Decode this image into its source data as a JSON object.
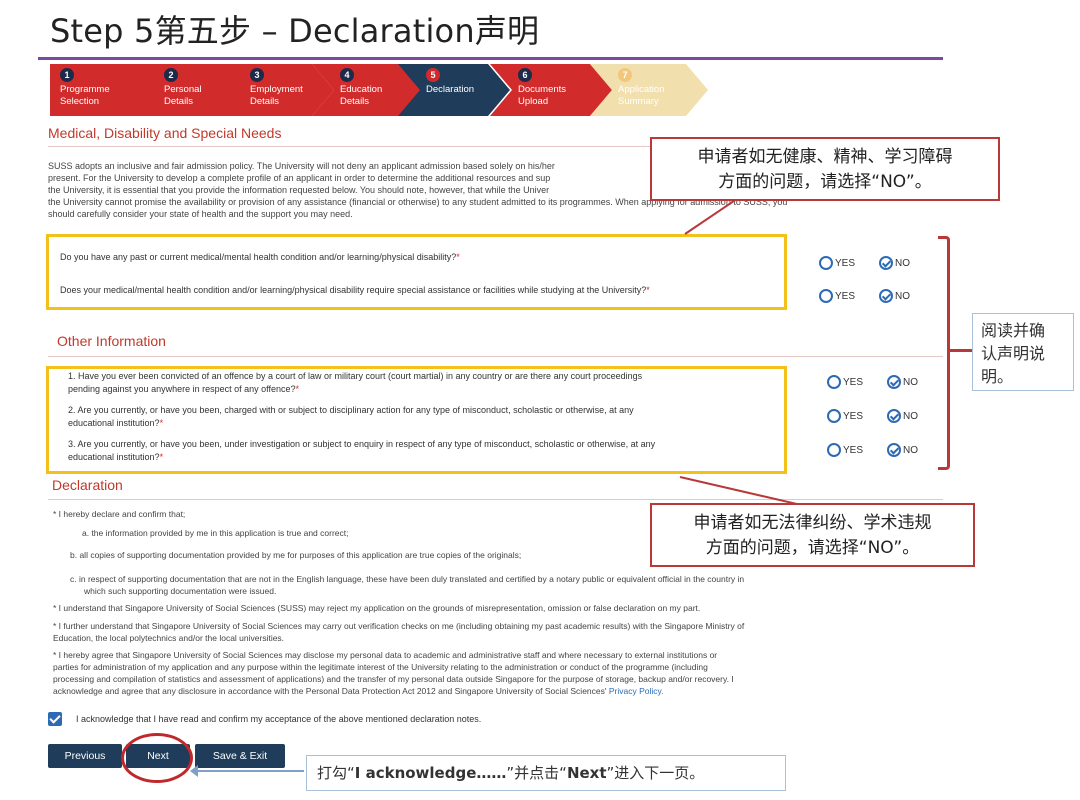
{
  "slide_title": "Step 5第五步 – Declaration声明",
  "steps": [
    {
      "num": "1",
      "line1": "Programme",
      "line2": "Selection"
    },
    {
      "num": "2",
      "line1": "Personal",
      "line2": "Details"
    },
    {
      "num": "3",
      "line1": "Employment",
      "line2": "Details"
    },
    {
      "num": "4",
      "line1": "Education",
      "line2": "Details"
    },
    {
      "num": "5",
      "line1": "Declaration",
      "line2": ""
    },
    {
      "num": "6",
      "line1": "Documents",
      "line2": "Upload"
    },
    {
      "num": "7",
      "line1": "Application",
      "line2": "Summary"
    }
  ],
  "colors": {
    "step_done": "#d12b2b",
    "step_active": "#1f3c5a",
    "step_future": "#f2dfae",
    "accent_red": "#c0392b",
    "box_yellow": "#f2c21a",
    "button_navy": "#1f3c5a"
  },
  "medical": {
    "title": "Medical, Disability and Special Needs",
    "intro": [
      "SUSS adopts an inclusive and fair admission policy. The University will not deny an applicant admission based solely on his/her",
      "present. For the University to develop a complete profile of an applicant in order to determine the additional resources and sup",
      "the University, it is essential that you provide the information requested below. You should note, however, that while the Univer",
      "the University cannot promise the availability or provision of any assistance (financial or otherwise) to any student admitted to its programmes. When applying for admission to SUSS, you",
      "should carefully consider your state of health and the support you may need."
    ],
    "q1": "Do you have any past or current medical/mental health condition and/or learning/physical disability?",
    "q2": "Does your medical/mental health condition and/or learning/physical disability require special assistance or facilities while studying at the University?"
  },
  "other": {
    "title": "Other Information",
    "q1a": "1. Have you ever been convicted of an offence by a court of law or military court (court martial) in any country or are there any court proceedings",
    "q1b": "pending against you anywhere in respect of any offence?",
    "q2a": "2. Are you currently, or have you been, charged with or subject to disciplinary action for any type of misconduct, scholastic or otherwise, at any",
    "q2b": "educational institution?",
    "q3a": "3. Are you currently, or have you been, under investigation or subject to enquiry in respect of any type of misconduct, scholastic or otherwise, at any",
    "q3b": "educational institution?"
  },
  "labels": {
    "yes": "YES",
    "no": "NO",
    "required": "*"
  },
  "declaration": {
    "title": "Declaration",
    "p1": "* I hereby declare and confirm that;",
    "a": "a. the information provided by me in this application is true and correct;",
    "b": "b. all copies of supporting documentation provided by me for purposes of this application are true copies of the originals;",
    "c1": "c. in respect of supporting documentation that are not in the English language, these have been duly translated and certified by a notary public or equivalent official in the country in",
    "c2": "which such supporting documentation were issued.",
    "p2": "* I understand that Singapore University of Social Sciences (SUSS) may reject my application on the grounds of misrepresentation, omission or false declaration on my part.",
    "p3a": "* I further understand that Singapore University of Social Sciences may carry out verification checks on me (including obtaining my past academic results) with the Singapore Ministry of",
    "p3b": "Education, the local polytechnics and/or the local universities.",
    "p4a": "* I hereby agree that Singapore University of Social Sciences may disclose my personal data to academic and administrative staff and where necessary to external institutions or",
    "p4b": "parties for administration of my application and any purpose within the legitimate interest of the University relating to the administration or conduct of the programme (including",
    "p4c": "processing and compilation of statistics and assessment of applications) and the transfer of my personal data outside Singapore for the purpose of storage, backup and/or recovery.  I",
    "p4d": "acknowledge and agree that any disclosure in accordance with the Personal Data Protection Act 2012 and Singapore University of Social Sciences'",
    "privacy_link": "Privacy Policy.",
    "ack": "I acknowledge that I have read and confirm my acceptance of the above mentioned declaration notes."
  },
  "buttons": {
    "previous": "Previous",
    "next": "Next",
    "save_exit": "Save & Exit"
  },
  "callouts": {
    "health_l1": "申请者如无健康、精神、学习障碍",
    "health_l2": "方面的问题，请选择“NO”。",
    "legal_l1": "申请者如无法律纠纷、学术违规",
    "legal_l2": "方面的问题，请选择“NO”。",
    "side_l1": "阅读并确",
    "side_l2": "认声明说",
    "side_l3": "明。",
    "bottom_pre": "打勾“",
    "bottom_b1": "I acknowledge……",
    "bottom_mid": "”并点击“",
    "bottom_b2": "Next",
    "bottom_post": "”进入下一页。"
  }
}
